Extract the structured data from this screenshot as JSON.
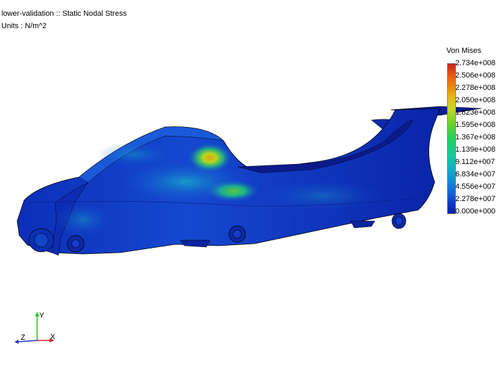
{
  "header": {
    "title": "lower-validation :: Static Nodal Stress",
    "units": "Units : N/m^2"
  },
  "legend": {
    "title": "Von Mises",
    "labels": [
      "2.734e+008",
      "2.506e+008",
      "2.278e+008",
      "2.050e+008",
      "1.823e+008",
      "1.595e+008",
      "1.367e+008",
      "1.139e+008",
      "9.112e+007",
      "6.834e+007",
      "4.556e+007",
      "2.278e+007",
      "0.000e+000"
    ]
  },
  "triad": {
    "x": "X",
    "y": "Y",
    "z": "Z"
  },
  "colors": {
    "low": "#0a1ea8",
    "mid": "#1ed25a",
    "high": "#c8281c"
  }
}
